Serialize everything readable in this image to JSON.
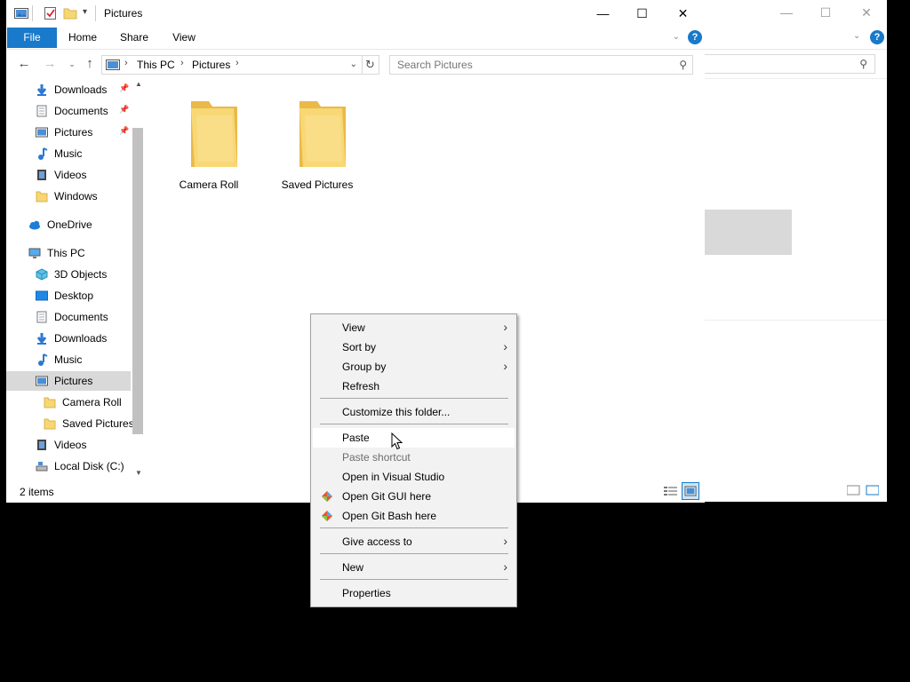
{
  "window": {
    "title": "Pictures",
    "controls": {
      "minimize": "—",
      "maximize": "☐",
      "close": "✕"
    }
  },
  "ribbon": {
    "tabs": [
      {
        "label": "File"
      },
      {
        "label": "Home"
      },
      {
        "label": "Share"
      },
      {
        "label": "View"
      }
    ],
    "help_label": "?"
  },
  "address": {
    "segments": [
      "This PC",
      "Pictures"
    ],
    "search_placeholder": "Search Pictures"
  },
  "nav_pane": {
    "items": [
      {
        "label": "Downloads",
        "icon": "download-arrow-icon",
        "pinned": true
      },
      {
        "label": "Documents",
        "icon": "document-icon",
        "pinned": true
      },
      {
        "label": "Pictures",
        "icon": "pictures-icon",
        "pinned": true
      },
      {
        "label": "Music",
        "icon": "music-note-icon",
        "pinned": false
      },
      {
        "label": "Videos",
        "icon": "film-icon",
        "pinned": false
      },
      {
        "label": "Windows",
        "icon": "folder-icon",
        "pinned": false
      },
      {
        "label": "OneDrive",
        "icon": "cloud-icon",
        "pinned": false
      },
      {
        "label": "This PC",
        "icon": "computer-icon",
        "pinned": false
      },
      {
        "label": "3D Objects",
        "icon": "cube-icon",
        "pinned": false
      },
      {
        "label": "Desktop",
        "icon": "desktop-icon",
        "pinned": false
      },
      {
        "label": "Documents",
        "icon": "document-icon",
        "pinned": false
      },
      {
        "label": "Downloads",
        "icon": "download-arrow-icon",
        "pinned": false
      },
      {
        "label": "Music",
        "icon": "music-note-icon",
        "pinned": false
      },
      {
        "label": "Pictures",
        "icon": "pictures-icon",
        "pinned": false,
        "selected": true
      },
      {
        "label": "Camera Roll",
        "icon": "folder-icon",
        "pinned": false
      },
      {
        "label": "Saved Pictures",
        "icon": "folder-icon",
        "pinned": false
      },
      {
        "label": "Videos",
        "icon": "film-icon",
        "pinned": false
      },
      {
        "label": "Local Disk (C:)",
        "icon": "drive-icon",
        "pinned": false
      }
    ]
  },
  "content": {
    "folders": [
      {
        "name": "Camera Roll"
      },
      {
        "name": "Saved Pictures"
      }
    ]
  },
  "status": {
    "item_count": "2 items"
  },
  "context_menu": {
    "items": [
      {
        "label": "View",
        "submenu": true
      },
      {
        "label": "Sort by",
        "submenu": true
      },
      {
        "label": "Group by",
        "submenu": true
      },
      {
        "label": "Refresh"
      },
      {
        "label": "Customize this folder..."
      },
      {
        "label": "Paste",
        "highlighted": true
      },
      {
        "label": "Paste shortcut",
        "disabled": true
      },
      {
        "label": "Open in Visual Studio"
      },
      {
        "label": "Open Git GUI here",
        "icon": "git-icon"
      },
      {
        "label": "Open Git Bash here",
        "icon": "git-icon"
      },
      {
        "label": "Give access to",
        "submenu": true
      },
      {
        "label": "New",
        "submenu": true
      },
      {
        "label": "Properties"
      }
    ],
    "submenu_glyph": "›"
  },
  "colors": {
    "accent": "#1979ca",
    "folder": "#f7d674",
    "selection": "#d9d9d9",
    "menu_bg": "#f2f2f2"
  }
}
